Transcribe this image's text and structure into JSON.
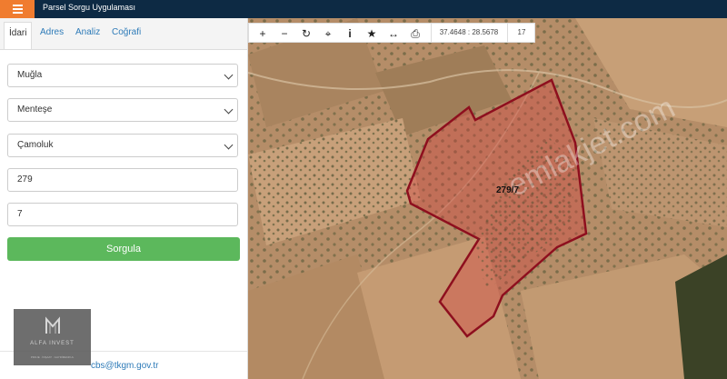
{
  "header": {
    "title": "Parsel Sorgu Uygulaması"
  },
  "tabs": [
    {
      "label": "İdari",
      "active": true
    },
    {
      "label": "Adres"
    },
    {
      "label": "Analiz"
    },
    {
      "label": "Coğrafi"
    }
  ],
  "form": {
    "province": "Muğla",
    "district": "Menteşe",
    "neighborhood": "Çamoluk",
    "block": "279",
    "parcel": "7",
    "submit_label": "Sorgula"
  },
  "footer": {
    "email": "cbs@tkgm.gov.tr"
  },
  "logo": {
    "name": "ALFA INVEST",
    "tagline": "PROJE · İNŞAAT · GAYRİMENKUL"
  },
  "map": {
    "coordinates": "37.4648 : 28.5678",
    "zoom": "17",
    "parcel_label": "279/7",
    "watermark": "emlakjet.com"
  },
  "toolbar": {
    "tools": [
      "plus-icon",
      "minus-icon",
      "refresh-icon",
      "locate-icon",
      "info-icon",
      "star-icon",
      "measure-icon",
      "print-icon"
    ]
  },
  "colors": {
    "header": "#0d2a44",
    "accent": "#f07c2f",
    "button": "#5cb85c",
    "parcel_outline": "#8e0f1e"
  }
}
